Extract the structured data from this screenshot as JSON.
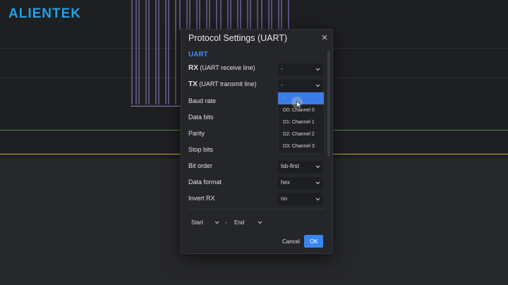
{
  "app": {
    "brand": "ALIENTEK"
  },
  "colors": {
    "accent": "#3b7de8",
    "brand": "#1fa0e6",
    "signal": "#9b7fd6",
    "trace_green": "#3c9a3c",
    "trace_yellow": "#c8b43a"
  },
  "dialog": {
    "title": "Protocol Settings  (UART)",
    "close_icon": "close-icon",
    "section": "UART",
    "rows": [
      {
        "key": "RX",
        "desc": " (UART receive line)",
        "value": "-"
      },
      {
        "key": "TX",
        "desc": " (UART transmit line)",
        "value": "-"
      },
      {
        "label": "Baud rate"
      },
      {
        "label": "Data bits"
      },
      {
        "label": "Parity"
      },
      {
        "label": "Stop bits"
      },
      {
        "label": "Bit order",
        "value": "lsb-first"
      },
      {
        "label": "Data format",
        "value": "hex"
      },
      {
        "label": "Invert RX",
        "value": "no"
      }
    ],
    "dropdown": {
      "options": [
        "-",
        "D0: Channel 0",
        "D1: Channel 1",
        "D2: Channel 2",
        "D3: Channel 3"
      ],
      "selected": "-"
    },
    "range": {
      "start": "Start",
      "separator": "-",
      "end": "End"
    },
    "buttons": {
      "cancel": "Cancel",
      "ok": "OK"
    }
  }
}
